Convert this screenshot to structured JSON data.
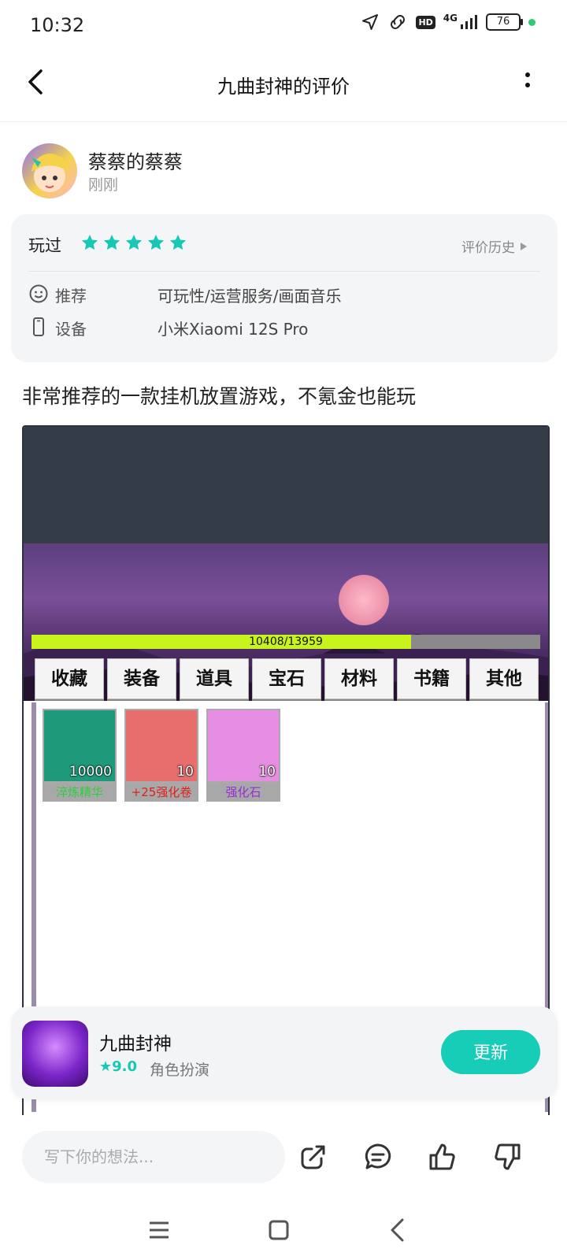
{
  "status_bar": {
    "time": "10:32",
    "network": "4G",
    "hd": "HD",
    "battery": "76"
  },
  "header": {
    "title": "九曲封神的评价"
  },
  "user": {
    "name": "蔡蔡的蔡蔡",
    "time": "刚刚"
  },
  "rating": {
    "played_label": "玩过",
    "stars": 5,
    "history_label": "评价历史",
    "recommend_label": "推荐",
    "recommend_value": "可玩性/运营服务/画面音乐",
    "device_label": "设备",
    "device_value": "小米Xiaomi 12S Pro"
  },
  "review_text": "非常推荐的一款挂机放置游戏，不氪金也能玩",
  "screenshot": {
    "hp_text": "10408/13959",
    "hp_fraction": 0.746,
    "tabs": [
      "收藏",
      "装备",
      "道具",
      "宝石",
      "材料",
      "书籍",
      "其他"
    ],
    "items": [
      {
        "name": "淬炼精华",
        "count": "10000",
        "name_color": "#2ecc40",
        "bg": "#1e9a7a"
      },
      {
        "name": "+25强化卷",
        "count": "10",
        "name_color": "#e0201c",
        "bg": "#e86d6d"
      },
      {
        "name": "强化石",
        "count": "10",
        "name_color": "#9a2bd6",
        "bg": "#e58de0"
      }
    ]
  },
  "app": {
    "name": "九曲封神",
    "score": "9.0",
    "category": "角色扮演",
    "button": "更新"
  },
  "comment_input": {
    "placeholder": "写下你的想法..."
  },
  "colors": {
    "accent": "#17cdb8",
    "star": "#17c8b5"
  }
}
